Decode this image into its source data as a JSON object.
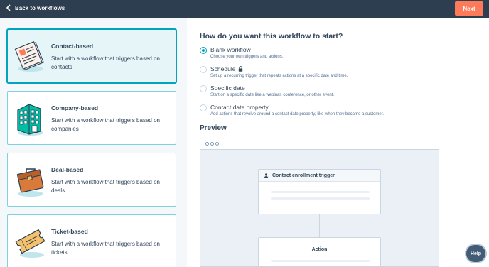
{
  "topbar": {
    "back_label": "Back to workflows",
    "next_label": "Next"
  },
  "cards": [
    {
      "title": "Contact-based",
      "desc": "Start with a workflow that triggers based on contacts",
      "icon": "contact-card-icon",
      "selected": true
    },
    {
      "title": "Company-based",
      "desc": "Start with a workflow that triggers based on companies",
      "icon": "building-icon",
      "selected": false
    },
    {
      "title": "Deal-based",
      "desc": "Start with a workflow that triggers based on deals",
      "icon": "briefcase-icon",
      "selected": false
    },
    {
      "title": "Ticket-based",
      "desc": "Start with a workflow that triggers based on tickets",
      "icon": "ticket-icon",
      "selected": false
    }
  ],
  "start": {
    "question": "How do you want this workflow to start?",
    "options": [
      {
        "label": "Blank workflow",
        "desc": "Choose your own triggers and actions.",
        "checked": true
      },
      {
        "label": "Schedule",
        "desc": "Set up a recurring trigger that repeats actions at a specific date and time.",
        "checked": false,
        "icon": "lock-icon"
      },
      {
        "label": "Specific date",
        "desc": "Start on a specific date like a webinar, conference, or other event.",
        "checked": false
      },
      {
        "label": "Contact date property",
        "desc": "Add actions that revolve around a contact date property, like when they became a customer.",
        "checked": false
      }
    ]
  },
  "preview": {
    "title": "Preview",
    "trigger_label": "Contact enrollment trigger",
    "action_label": "Action"
  },
  "help_label": "Help",
  "colors": {
    "accent": "#00a4bd",
    "cta": "#ff7a59",
    "topbar": "#2d3e50"
  }
}
